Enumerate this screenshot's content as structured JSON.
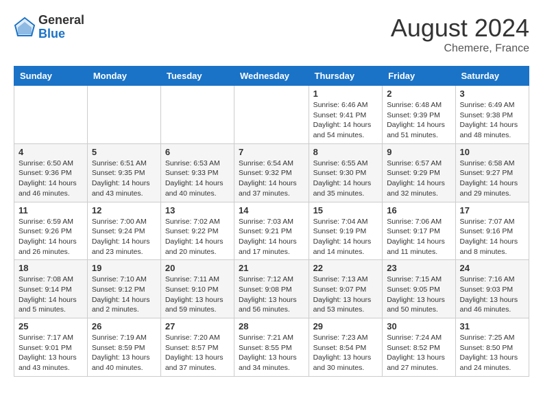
{
  "header": {
    "logo_general": "General",
    "logo_blue": "Blue",
    "month_year": "August 2024",
    "location": "Chemere, France"
  },
  "weekdays": [
    "Sunday",
    "Monday",
    "Tuesday",
    "Wednesday",
    "Thursday",
    "Friday",
    "Saturday"
  ],
  "weeks": [
    [
      {
        "day": "",
        "data": ""
      },
      {
        "day": "",
        "data": ""
      },
      {
        "day": "",
        "data": ""
      },
      {
        "day": "",
        "data": ""
      },
      {
        "day": "1",
        "data": "Sunrise: 6:46 AM\nSunset: 9:41 PM\nDaylight: 14 hours\nand 54 minutes."
      },
      {
        "day": "2",
        "data": "Sunrise: 6:48 AM\nSunset: 9:39 PM\nDaylight: 14 hours\nand 51 minutes."
      },
      {
        "day": "3",
        "data": "Sunrise: 6:49 AM\nSunset: 9:38 PM\nDaylight: 14 hours\nand 48 minutes."
      }
    ],
    [
      {
        "day": "4",
        "data": "Sunrise: 6:50 AM\nSunset: 9:36 PM\nDaylight: 14 hours\nand 46 minutes."
      },
      {
        "day": "5",
        "data": "Sunrise: 6:51 AM\nSunset: 9:35 PM\nDaylight: 14 hours\nand 43 minutes."
      },
      {
        "day": "6",
        "data": "Sunrise: 6:53 AM\nSunset: 9:33 PM\nDaylight: 14 hours\nand 40 minutes."
      },
      {
        "day": "7",
        "data": "Sunrise: 6:54 AM\nSunset: 9:32 PM\nDaylight: 14 hours\nand 37 minutes."
      },
      {
        "day": "8",
        "data": "Sunrise: 6:55 AM\nSunset: 9:30 PM\nDaylight: 14 hours\nand 35 minutes."
      },
      {
        "day": "9",
        "data": "Sunrise: 6:57 AM\nSunset: 9:29 PM\nDaylight: 14 hours\nand 32 minutes."
      },
      {
        "day": "10",
        "data": "Sunrise: 6:58 AM\nSunset: 9:27 PM\nDaylight: 14 hours\nand 29 minutes."
      }
    ],
    [
      {
        "day": "11",
        "data": "Sunrise: 6:59 AM\nSunset: 9:26 PM\nDaylight: 14 hours\nand 26 minutes."
      },
      {
        "day": "12",
        "data": "Sunrise: 7:00 AM\nSunset: 9:24 PM\nDaylight: 14 hours\nand 23 minutes."
      },
      {
        "day": "13",
        "data": "Sunrise: 7:02 AM\nSunset: 9:22 PM\nDaylight: 14 hours\nand 20 minutes."
      },
      {
        "day": "14",
        "data": "Sunrise: 7:03 AM\nSunset: 9:21 PM\nDaylight: 14 hours\nand 17 minutes."
      },
      {
        "day": "15",
        "data": "Sunrise: 7:04 AM\nSunset: 9:19 PM\nDaylight: 14 hours\nand 14 minutes."
      },
      {
        "day": "16",
        "data": "Sunrise: 7:06 AM\nSunset: 9:17 PM\nDaylight: 14 hours\nand 11 minutes."
      },
      {
        "day": "17",
        "data": "Sunrise: 7:07 AM\nSunset: 9:16 PM\nDaylight: 14 hours\nand 8 minutes."
      }
    ],
    [
      {
        "day": "18",
        "data": "Sunrise: 7:08 AM\nSunset: 9:14 PM\nDaylight: 14 hours\nand 5 minutes."
      },
      {
        "day": "19",
        "data": "Sunrise: 7:10 AM\nSunset: 9:12 PM\nDaylight: 14 hours\nand 2 minutes."
      },
      {
        "day": "20",
        "data": "Sunrise: 7:11 AM\nSunset: 9:10 PM\nDaylight: 13 hours\nand 59 minutes."
      },
      {
        "day": "21",
        "data": "Sunrise: 7:12 AM\nSunset: 9:08 PM\nDaylight: 13 hours\nand 56 minutes."
      },
      {
        "day": "22",
        "data": "Sunrise: 7:13 AM\nSunset: 9:07 PM\nDaylight: 13 hours\nand 53 minutes."
      },
      {
        "day": "23",
        "data": "Sunrise: 7:15 AM\nSunset: 9:05 PM\nDaylight: 13 hours\nand 50 minutes."
      },
      {
        "day": "24",
        "data": "Sunrise: 7:16 AM\nSunset: 9:03 PM\nDaylight: 13 hours\nand 46 minutes."
      }
    ],
    [
      {
        "day": "25",
        "data": "Sunrise: 7:17 AM\nSunset: 9:01 PM\nDaylight: 13 hours\nand 43 minutes."
      },
      {
        "day": "26",
        "data": "Sunrise: 7:19 AM\nSunset: 8:59 PM\nDaylight: 13 hours\nand 40 minutes."
      },
      {
        "day": "27",
        "data": "Sunrise: 7:20 AM\nSunset: 8:57 PM\nDaylight: 13 hours\nand 37 minutes."
      },
      {
        "day": "28",
        "data": "Sunrise: 7:21 AM\nSunset: 8:55 PM\nDaylight: 13 hours\nand 34 minutes."
      },
      {
        "day": "29",
        "data": "Sunrise: 7:23 AM\nSunset: 8:54 PM\nDaylight: 13 hours\nand 30 minutes."
      },
      {
        "day": "30",
        "data": "Sunrise: 7:24 AM\nSunset: 8:52 PM\nDaylight: 13 hours\nand 27 minutes."
      },
      {
        "day": "31",
        "data": "Sunrise: 7:25 AM\nSunset: 8:50 PM\nDaylight: 13 hours\nand 24 minutes."
      }
    ]
  ]
}
